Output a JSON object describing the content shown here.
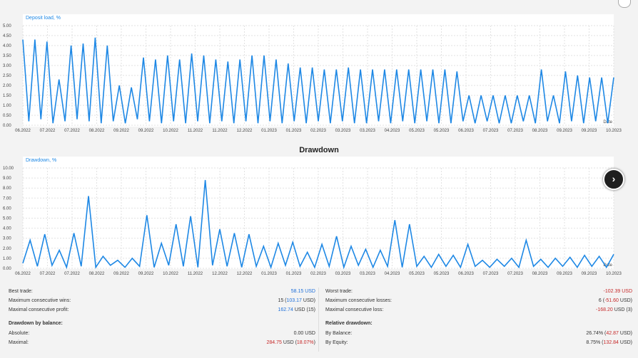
{
  "top_chart": {
    "legend": "Deposit load, %",
    "y_ticks": [
      "5.00",
      "4.50",
      "4.00",
      "3.50",
      "3.00",
      "2.50",
      "2.00",
      "1.50",
      "1.00",
      "0.50",
      "0.00"
    ],
    "x_ticks": [
      "06.2022",
      "07.2022",
      "07.2022",
      "08.2022",
      "09.2022",
      "09.2022",
      "10.2022",
      "11.2022",
      "11.2022",
      "12.2022",
      "01.2023",
      "01.2023",
      "02.2023",
      "03.2023",
      "03.2023",
      "04.2023",
      "05.2023",
      "05.2023",
      "06.2023",
      "07.2023",
      "07.2023",
      "08.2023",
      "09.2023",
      "09.2023",
      "10.2023"
    ],
    "corner_label": "Date",
    "color": "#1e88e5"
  },
  "chart_title": "Drawdown",
  "bottom_chart": {
    "legend": "Drawdown, %",
    "y_ticks": [
      "10.00",
      "9.00",
      "8.00",
      "7.00",
      "6.00",
      "5.00",
      "4.00",
      "3.00",
      "2.00",
      "1.00",
      "0.00"
    ],
    "x_ticks": [
      "06.2022",
      "07.2022",
      "07.2022",
      "08.2022",
      "09.2022",
      "09.2022",
      "10.2022",
      "11.2022",
      "12.2022",
      "12.2022",
      "01.2023",
      "01.2023",
      "02.2023",
      "03.2023",
      "03.2023",
      "04.2023",
      "05.2023",
      "05.2023",
      "06.2023",
      "07.2023",
      "07.2023",
      "08.2023",
      "09.2023",
      "09.2023",
      "10.2023"
    ],
    "corner_label": "Date",
    "color": "#1e88e5"
  },
  "stats": {
    "left": [
      {
        "label": "Best trade:",
        "value": "58.15 USD"
      },
      {
        "label": "Maximum consecutive wins:",
        "value": "15 (103.17 USD)"
      },
      {
        "label": "Maximal consecutive profit:",
        "value": "162.74 USD (15)"
      }
    ],
    "right": [
      {
        "label": "Worst trade:",
        "value": "-102.39 USD"
      },
      {
        "label": "Maximum consecutive losses:",
        "value": "6 (-51.60 USD)"
      },
      {
        "label": "Maximal consecutive loss:",
        "value": "-168.20 USD (3)"
      }
    ],
    "balance_header": "Drawdown by balance:",
    "balance": [
      {
        "label": "Absolute:",
        "value": "0.00 USD"
      },
      {
        "label": "Maximal:",
        "value": "284.75 USD (18.07%)"
      }
    ],
    "relative_header": "Relative drawdown:",
    "relative": [
      {
        "label": "By Balance:",
        "value": "26.74% (42.87 USD)"
      },
      {
        "label": "By Equity:",
        "value": "8.75% (132.84 USD)"
      }
    ]
  },
  "chart_data": [
    {
      "type": "line",
      "title": "",
      "legend": "Deposit load, %",
      "ylim": [
        0,
        5
      ],
      "x_range": [
        "06.2022",
        "10.2023"
      ],
      "series": [
        {
          "name": "Deposit load, %",
          "values": [
            4.3,
            0.2,
            4.3,
            0.3,
            4.2,
            0.1,
            2.3,
            0.2,
            4.0,
            0.3,
            4.1,
            0.2,
            4.4,
            0.1,
            4.0,
            0.2,
            2.0,
            0.1,
            1.9,
            0.3,
            3.4,
            0.2,
            3.3,
            0.1,
            3.5,
            0.2,
            3.3,
            0.1,
            3.6,
            0.2,
            3.5,
            0.1,
            3.3,
            0.2,
            3.2,
            0.1,
            3.3,
            0.2,
            3.5,
            0.1,
            3.5,
            0.2,
            3.3,
            0.1,
            3.1,
            0.2,
            2.9,
            0.1,
            2.9,
            0.2,
            2.8,
            0.1,
            2.8,
            0.2,
            2.9,
            0.1,
            2.8,
            0.1,
            2.8,
            0.2,
            2.8,
            0.1,
            2.8,
            0.2,
            2.8,
            0.1,
            2.8,
            0.2,
            2.8,
            0.1,
            2.8,
            0.1,
            2.7,
            0.2,
            1.5,
            0.1,
            1.5,
            0.2,
            1.5,
            0.1,
            1.5,
            0.1,
            1.5,
            0.2,
            1.5,
            0.1,
            2.8,
            0.2,
            1.5,
            0.1,
            2.7,
            0.2,
            2.5,
            0.1,
            2.4,
            0.2,
            2.4,
            0.1,
            2.4
          ]
        }
      ],
      "grid": true
    },
    {
      "type": "line",
      "title": "Drawdown",
      "legend": "Drawdown, %",
      "ylim": [
        0,
        10
      ],
      "x_range": [
        "06.2022",
        "10.2023"
      ],
      "series": [
        {
          "name": "Drawdown, %",
          "values": [
            0.5,
            2.8,
            0.2,
            3.4,
            0.3,
            1.8,
            0.1,
            3.5,
            0.2,
            7.2,
            0.1,
            1.2,
            0.3,
            0.8,
            0.1,
            1.0,
            0.2,
            5.3,
            0.1,
            2.5,
            0.3,
            4.4,
            0.2,
            5.2,
            0.1,
            8.8,
            0.3,
            3.9,
            0.2,
            3.5,
            0.1,
            3.4,
            0.2,
            2.2,
            0.1,
            2.5,
            0.3,
            2.6,
            0.2,
            1.6,
            0.1,
            2.4,
            0.2,
            3.2,
            0.1,
            2.2,
            0.3,
            1.9,
            0.1,
            1.8,
            0.2,
            4.8,
            0.1,
            4.4,
            0.2,
            1.2,
            0.1,
            1.4,
            0.2,
            1.3,
            0.1,
            2.4,
            0.2,
            0.8,
            0.1,
            0.9,
            0.2,
            1.0,
            0.1,
            2.8,
            0.2,
            0.9,
            0.1,
            1.0,
            0.2,
            1.1,
            0.1,
            1.3,
            0.2,
            1.2,
            0.1,
            1.4
          ]
        }
      ],
      "grid": true
    }
  ]
}
